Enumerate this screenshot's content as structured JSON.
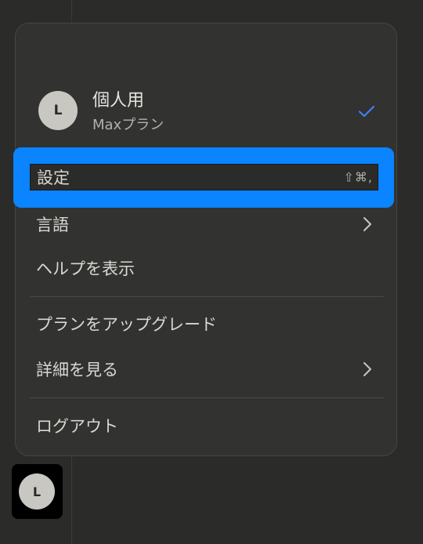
{
  "account": {
    "avatar_initial": "L",
    "name": "個人用",
    "plan": "Maxプラン"
  },
  "menu": {
    "settings": {
      "label": "設定",
      "shortcut": "⇧⌘,"
    },
    "language": {
      "label": "言語"
    },
    "help": {
      "label": "ヘルプを表示"
    },
    "upgrade": {
      "label": "プランをアップグレード"
    },
    "details": {
      "label": "詳細を見る"
    },
    "logout": {
      "label": "ログアウト"
    }
  },
  "sidebar": {
    "avatar_initial": "L"
  },
  "colors": {
    "accent": "#0a84ff",
    "check": "#3b82f6",
    "menu_bg": "#323231",
    "page_bg": "#2b2b2a"
  },
  "icons": {
    "check": "checkmark-icon",
    "chevron": "chevron-right-icon"
  }
}
